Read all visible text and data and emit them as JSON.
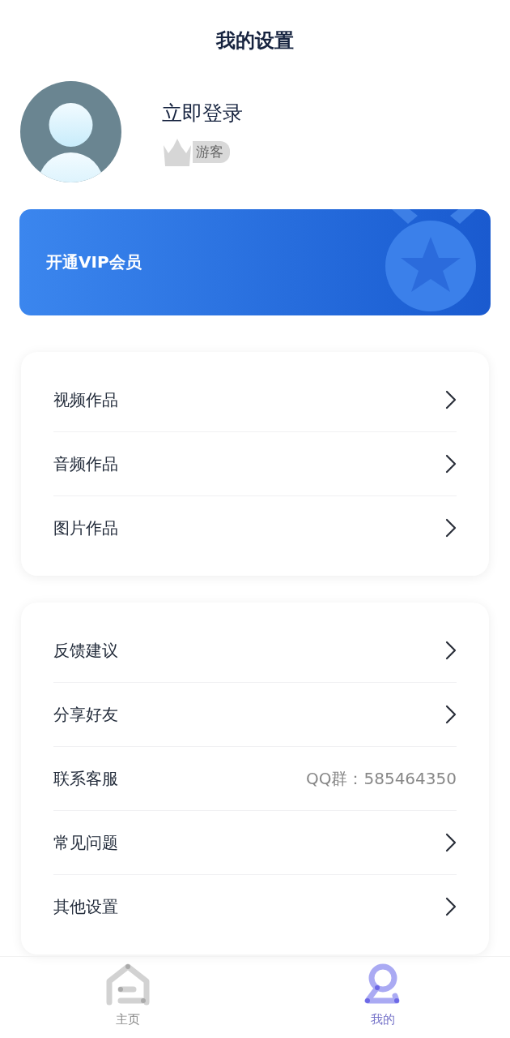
{
  "title": "我的设置",
  "profile": {
    "login": "立即登录",
    "badge": "游客"
  },
  "vip": {
    "label": "开通VIP会员"
  },
  "groups": [
    {
      "items": [
        {
          "kind": "link",
          "label": "视频作品"
        },
        {
          "kind": "link",
          "label": "音频作品"
        },
        {
          "kind": "link",
          "label": "图片作品"
        }
      ]
    },
    {
      "items": [
        {
          "kind": "link",
          "label": "反馈建议"
        },
        {
          "kind": "link",
          "label": "分享好友"
        },
        {
          "kind": "info",
          "label": "联系客服",
          "value": "QQ群：585464350"
        },
        {
          "kind": "link",
          "label": "常见问题"
        },
        {
          "kind": "link",
          "label": "其他设置"
        }
      ]
    }
  ],
  "tabs": [
    {
      "kind": "home",
      "label": "主页",
      "selected": false
    },
    {
      "kind": "profile",
      "label": "我的",
      "selected": true
    }
  ]
}
